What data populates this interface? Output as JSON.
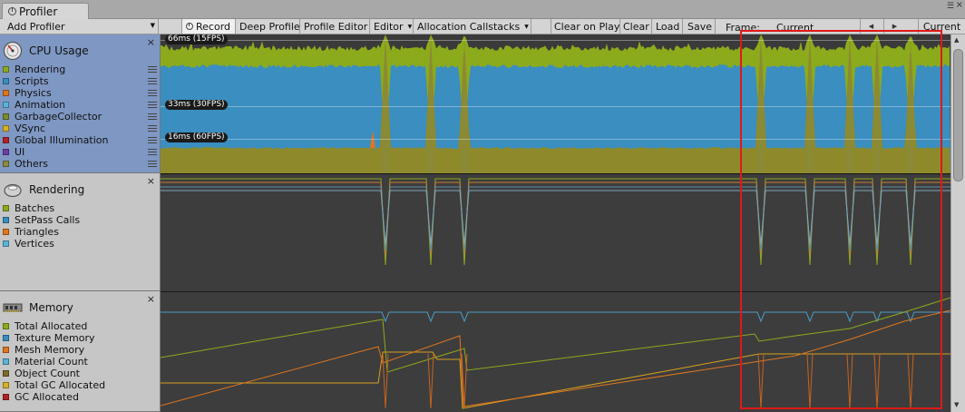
{
  "window": {
    "tab_title": "Profiler"
  },
  "toolbar": {
    "add_profiler": "Add Profiler",
    "record": "Record",
    "deep_profile": "Deep Profile",
    "profile_editor": "Profile Editor",
    "editor": "Editor",
    "allocation_callstacks": "Allocation Callstacks",
    "clear_on_play": "Clear on Play",
    "clear": "Clear",
    "load": "Load",
    "save": "Save",
    "frame_label": "Frame:",
    "frame_value": "Current",
    "current": "Current"
  },
  "cpu": {
    "title": "CPU Usage",
    "items": [
      {
        "label": "Rendering",
        "color": "#8cab1c"
      },
      {
        "label": "Scripts",
        "color": "#3a8ec0"
      },
      {
        "label": "Physics",
        "color": "#e0761e"
      },
      {
        "label": "Animation",
        "color": "#5ab4d8"
      },
      {
        "label": "GarbageCollector",
        "color": "#7a8c2a"
      },
      {
        "label": "VSync",
        "color": "#d8b022"
      },
      {
        "label": "Global Illumination",
        "color": "#b22222"
      },
      {
        "label": "UI",
        "color": "#6a3fa8"
      },
      {
        "label": "Others",
        "color": "#8a8a3a"
      }
    ],
    "fps_labels": [
      "66ms (15FPS)",
      "33ms (30FPS)",
      "16ms (60FPS)"
    ]
  },
  "rendering": {
    "title": "Rendering",
    "items": [
      {
        "label": "Batches",
        "color": "#8cab1c"
      },
      {
        "label": "SetPass Calls",
        "color": "#3a8ec0"
      },
      {
        "label": "Triangles",
        "color": "#e0761e"
      },
      {
        "label": "Vertices",
        "color": "#5ab4d8"
      }
    ]
  },
  "memory": {
    "title": "Memory",
    "items": [
      {
        "label": "Total Allocated",
        "color": "#8cab1c"
      },
      {
        "label": "Texture Memory",
        "color": "#3a8ec0"
      },
      {
        "label": "Mesh Memory",
        "color": "#e0761e"
      },
      {
        "label": "Material Count",
        "color": "#5ab4d8"
      },
      {
        "label": "Object Count",
        "color": "#7a6a2a"
      },
      {
        "label": "Total GC Allocated",
        "color": "#d8b022"
      },
      {
        "label": "GC Allocated",
        "color": "#b22222"
      }
    ]
  },
  "spike_frames": [
    248,
    298,
    335,
    662,
    716,
    760,
    790,
    827
  ]
}
